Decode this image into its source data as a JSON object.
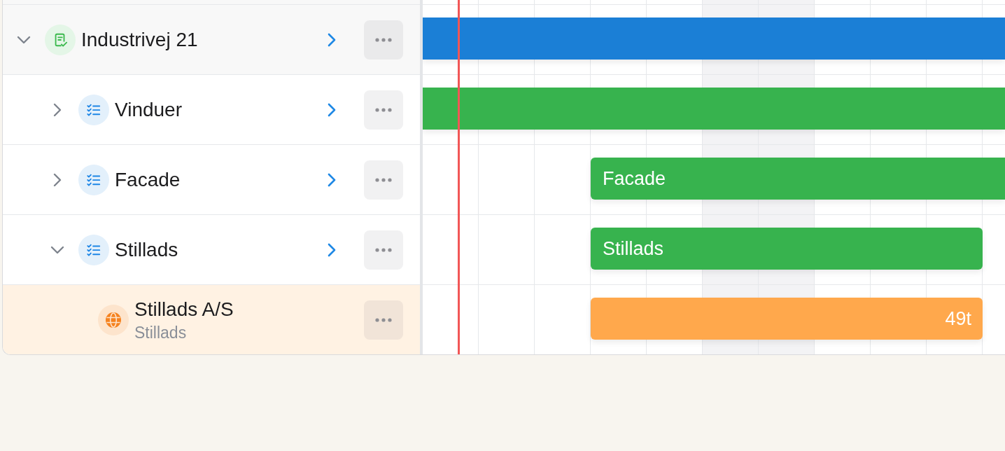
{
  "timeline": {
    "columns": [
      {
        "kind": "plain"
      },
      {
        "kind": "plain"
      },
      {
        "kind": "plain"
      },
      {
        "kind": "plain"
      },
      {
        "kind": "plain"
      },
      {
        "kind": "shaded"
      },
      {
        "kind": "shaded"
      },
      {
        "kind": "plain"
      },
      {
        "kind": "plain"
      },
      {
        "kind": "plain"
      },
      {
        "kind": "plain"
      }
    ]
  },
  "tree": [
    {
      "kind": "project",
      "label": "Industrivej 21",
      "expanded": true,
      "bar": {
        "color": "#1b7fd6"
      },
      "children": [
        {
          "kind": "task",
          "label": "Vinduer",
          "expanded": false,
          "bar": {
            "color": "#37b34e"
          }
        },
        {
          "kind": "task",
          "label": "Facade",
          "expanded": false,
          "bar": {
            "color": "#37b34e",
            "label": "Facade"
          }
        },
        {
          "kind": "task",
          "label": "Stillads",
          "expanded": true,
          "bar": {
            "color": "#37b34e",
            "label": "Stillads"
          },
          "children": [
            {
              "kind": "resource",
              "label": "Stillads A/S",
              "subtitle": "Stillads",
              "bar": {
                "color": "#ffa84c",
                "duration": "49t"
              }
            }
          ]
        }
      ]
    }
  ]
}
